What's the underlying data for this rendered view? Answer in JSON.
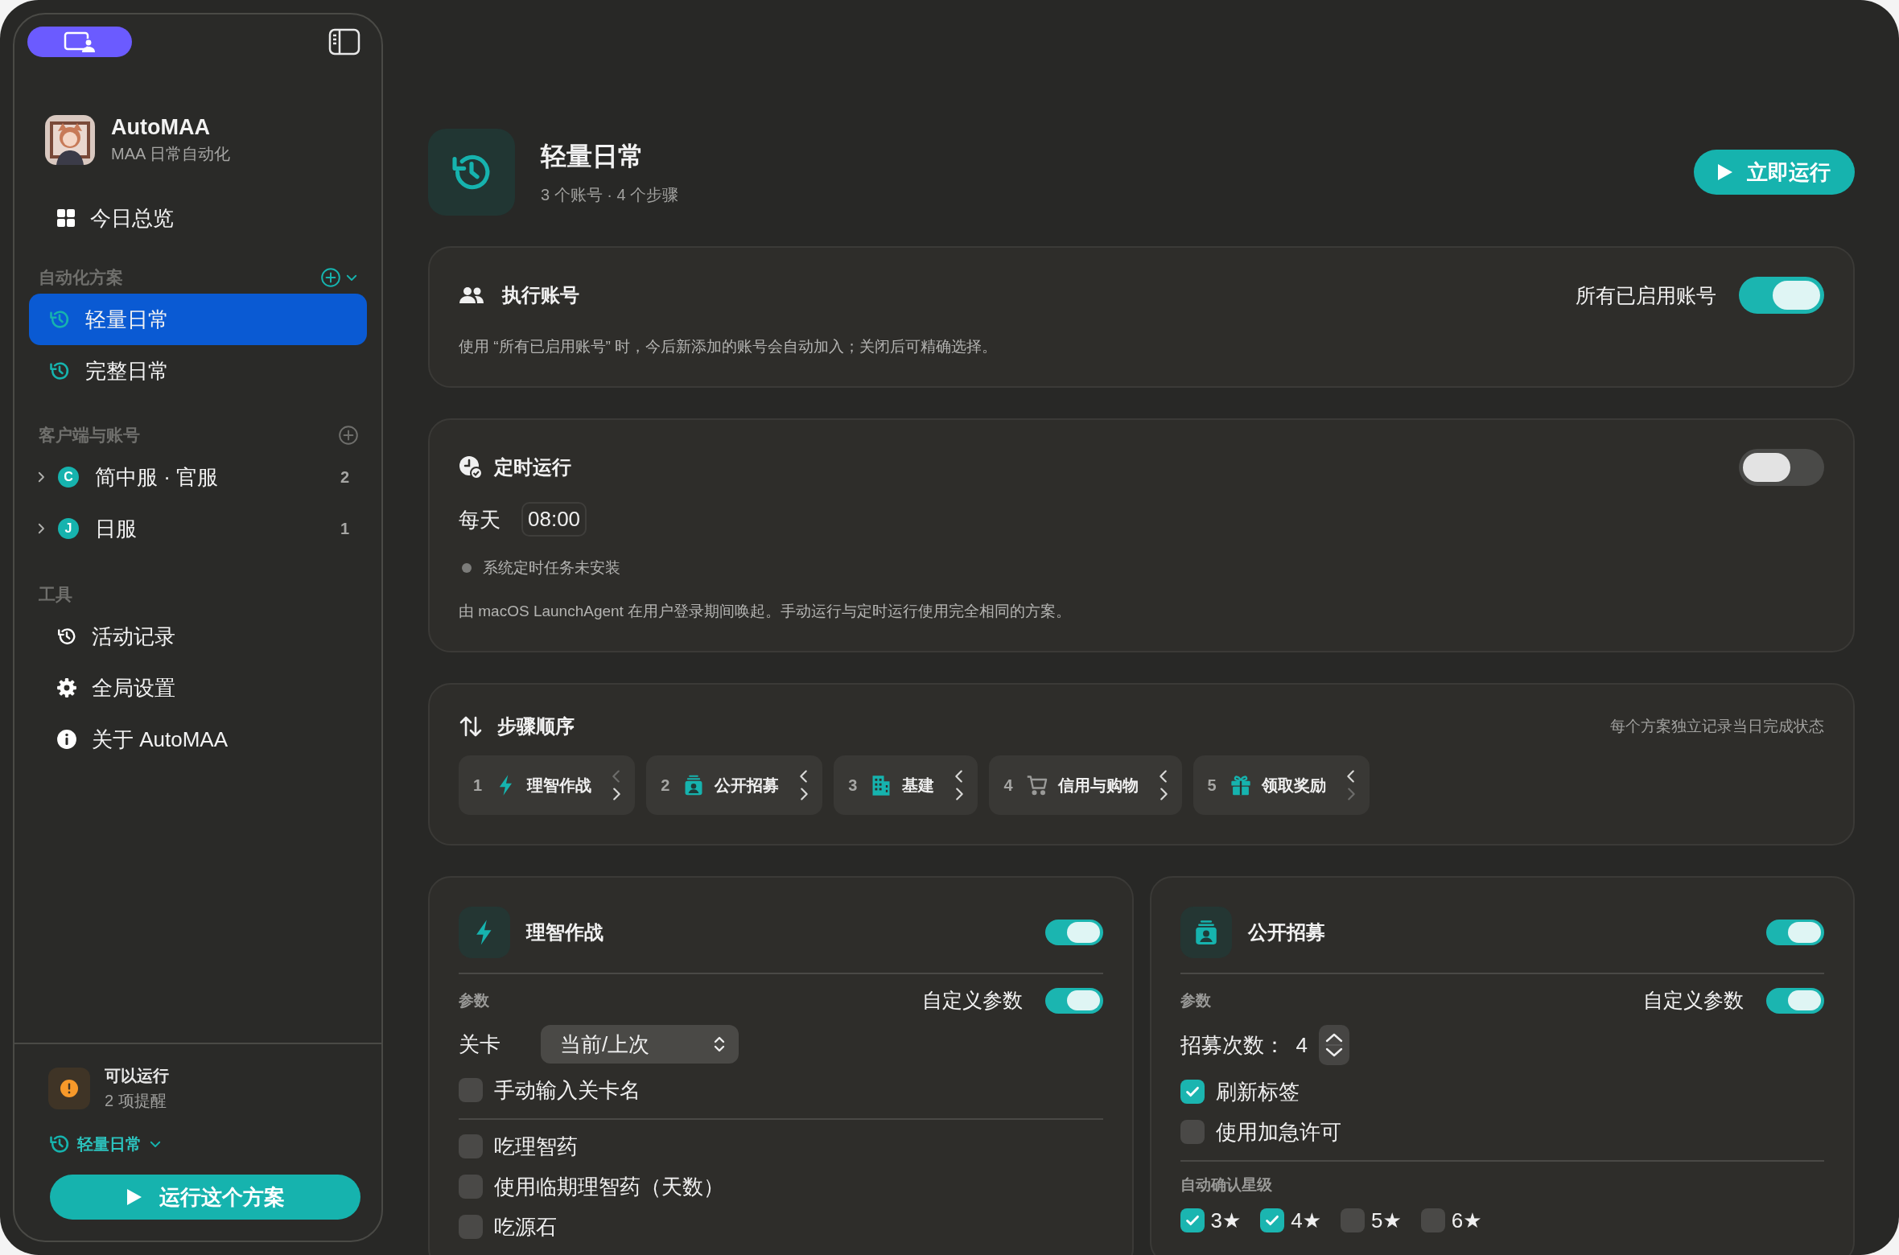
{
  "sidebar": {
    "app_name": "AutoMAA",
    "app_subtitle": "MAA 日常自动化",
    "overview": "今日总览",
    "plans": {
      "title": "自动化方案",
      "items": [
        {
          "label": "轻量日常",
          "selected": true
        },
        {
          "label": "完整日常",
          "selected": false
        }
      ]
    },
    "clients": {
      "title": "客户端与账号",
      "items": [
        {
          "label": "简中服 · 官服",
          "badge": "C",
          "count": "2",
          "expanded": false
        },
        {
          "label": "日服",
          "badge": "J",
          "count": "1",
          "expanded": false
        }
      ]
    },
    "tools": {
      "title": "工具",
      "items": [
        {
          "label": "活动记录",
          "kind": "history"
        },
        {
          "label": "全局设置",
          "kind": "gear"
        },
        {
          "label": "关于 AutoMAA",
          "kind": "info"
        }
      ]
    },
    "status": {
      "title": "可以运行",
      "subtitle": "2 项提醒"
    },
    "plan_picker": "轻量日常",
    "run_button": "运行这个方案"
  },
  "header": {
    "title": "轻量日常",
    "subtitle": "3 个账号 · 4 个步骤",
    "run_button": "立即运行"
  },
  "accounts_card": {
    "title": "执行账号",
    "toggle_label": "所有已启用账号",
    "on": true,
    "note": "使用 “所有已启用账号” 时，今后新添加的账号会自动加入；关闭后可精确选择。"
  },
  "schedule_card": {
    "title": "定时运行",
    "on": false,
    "frequency": "每天",
    "time": "08:00",
    "status": "系统定时任务未安装",
    "note": "由 macOS LaunchAgent 在用户登录期间唤起。手动运行与定时运行使用完全相同的方案。"
  },
  "steps_card": {
    "title": "步骤顺序",
    "note": "每个方案独立记录当日完成状态",
    "steps": [
      {
        "index": "1",
        "label": "理智作战",
        "kind": "bolt",
        "up_enabled": false,
        "down_enabled": true
      },
      {
        "index": "2",
        "label": "公开招募",
        "kind": "recruit",
        "up_enabled": true,
        "down_enabled": true
      },
      {
        "index": "3",
        "label": "基建",
        "kind": "building",
        "up_enabled": true,
        "down_enabled": true
      },
      {
        "index": "4",
        "label": "信用与购物",
        "kind": "cart",
        "up_enabled": true,
        "down_enabled": true
      },
      {
        "index": "5",
        "label": "领取奖励",
        "kind": "gift",
        "up_enabled": true,
        "down_enabled": false
      }
    ]
  },
  "tasks": [
    {
      "title": "理智作战",
      "kind": "bolt",
      "on": true,
      "params_label": "参数",
      "custom_label": "自定义参数",
      "custom_on": true,
      "rows": [
        {
          "kind": "select",
          "label": "关卡",
          "value": "当前/上次"
        },
        {
          "kind": "check",
          "label": "手动输入关卡名",
          "checked": false
        },
        {
          "kind": "divider"
        },
        {
          "kind": "check",
          "label": "吃理智药",
          "checked": false
        },
        {
          "kind": "check",
          "label": "使用临期理智药（天数）",
          "checked": false
        },
        {
          "kind": "check",
          "label": "吃源石",
          "checked": false
        }
      ]
    },
    {
      "title": "公开招募",
      "kind": "recruit",
      "on": true,
      "params_label": "参数",
      "custom_label": "自定义参数",
      "custom_on": true,
      "rows": [
        {
          "kind": "stepper",
          "label": "招募次数：",
          "value": "4"
        },
        {
          "kind": "check",
          "label": "刷新标签",
          "checked": true
        },
        {
          "kind": "check",
          "label": "使用加急许可",
          "checked": false
        },
        {
          "kind": "divider"
        },
        {
          "kind": "heading",
          "label": "自动确认星级"
        },
        {
          "kind": "checks",
          "items": [
            {
              "label": "3★",
              "checked": true
            },
            {
              "label": "4★",
              "checked": true
            },
            {
              "label": "5★",
              "checked": false
            },
            {
              "label": "6★",
              "checked": false
            }
          ]
        }
      ]
    }
  ]
}
